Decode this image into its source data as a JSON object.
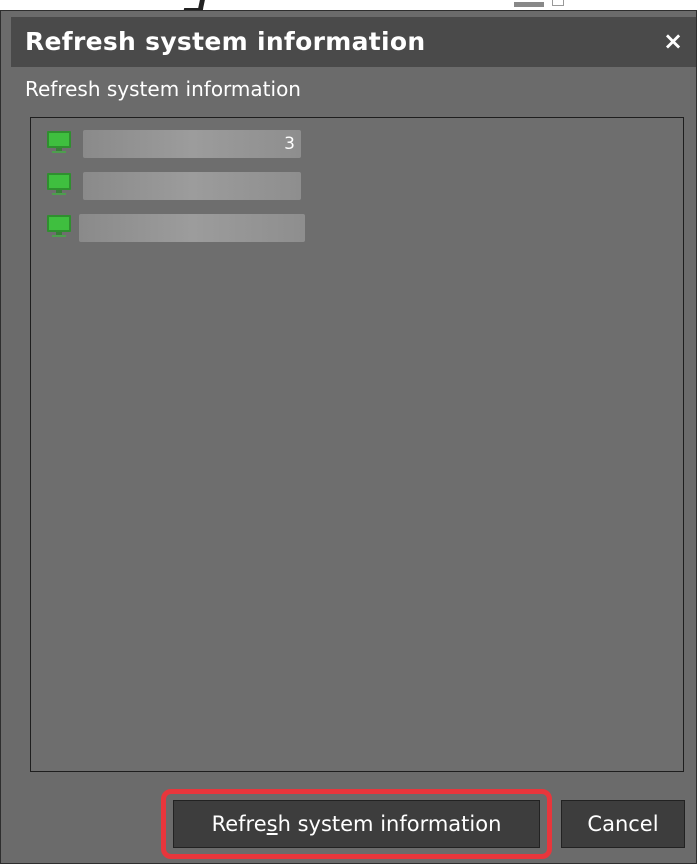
{
  "dialog": {
    "title": "Refresh system information",
    "close_glyph": "×",
    "subtitle": "Refresh system information"
  },
  "list": {
    "items": [
      {
        "icon": "monitor-icon",
        "label": "3",
        "blurred": true
      },
      {
        "icon": "monitor-icon",
        "label": "",
        "blurred": true
      },
      {
        "icon": "monitor-icon",
        "label": "",
        "blurred": true
      }
    ]
  },
  "buttons": {
    "refresh_prefix": "Refre",
    "refresh_mnemonic": "s",
    "refresh_suffix": "h system information",
    "cancel_label": "Cancel"
  },
  "colors": {
    "dialog_bg": "#6b6b6b",
    "titlebar_bg": "#4a4a4a",
    "button_bg": "#3d3d3d",
    "highlight": "#e8363c",
    "monitor_green": "#3fbf3f"
  }
}
